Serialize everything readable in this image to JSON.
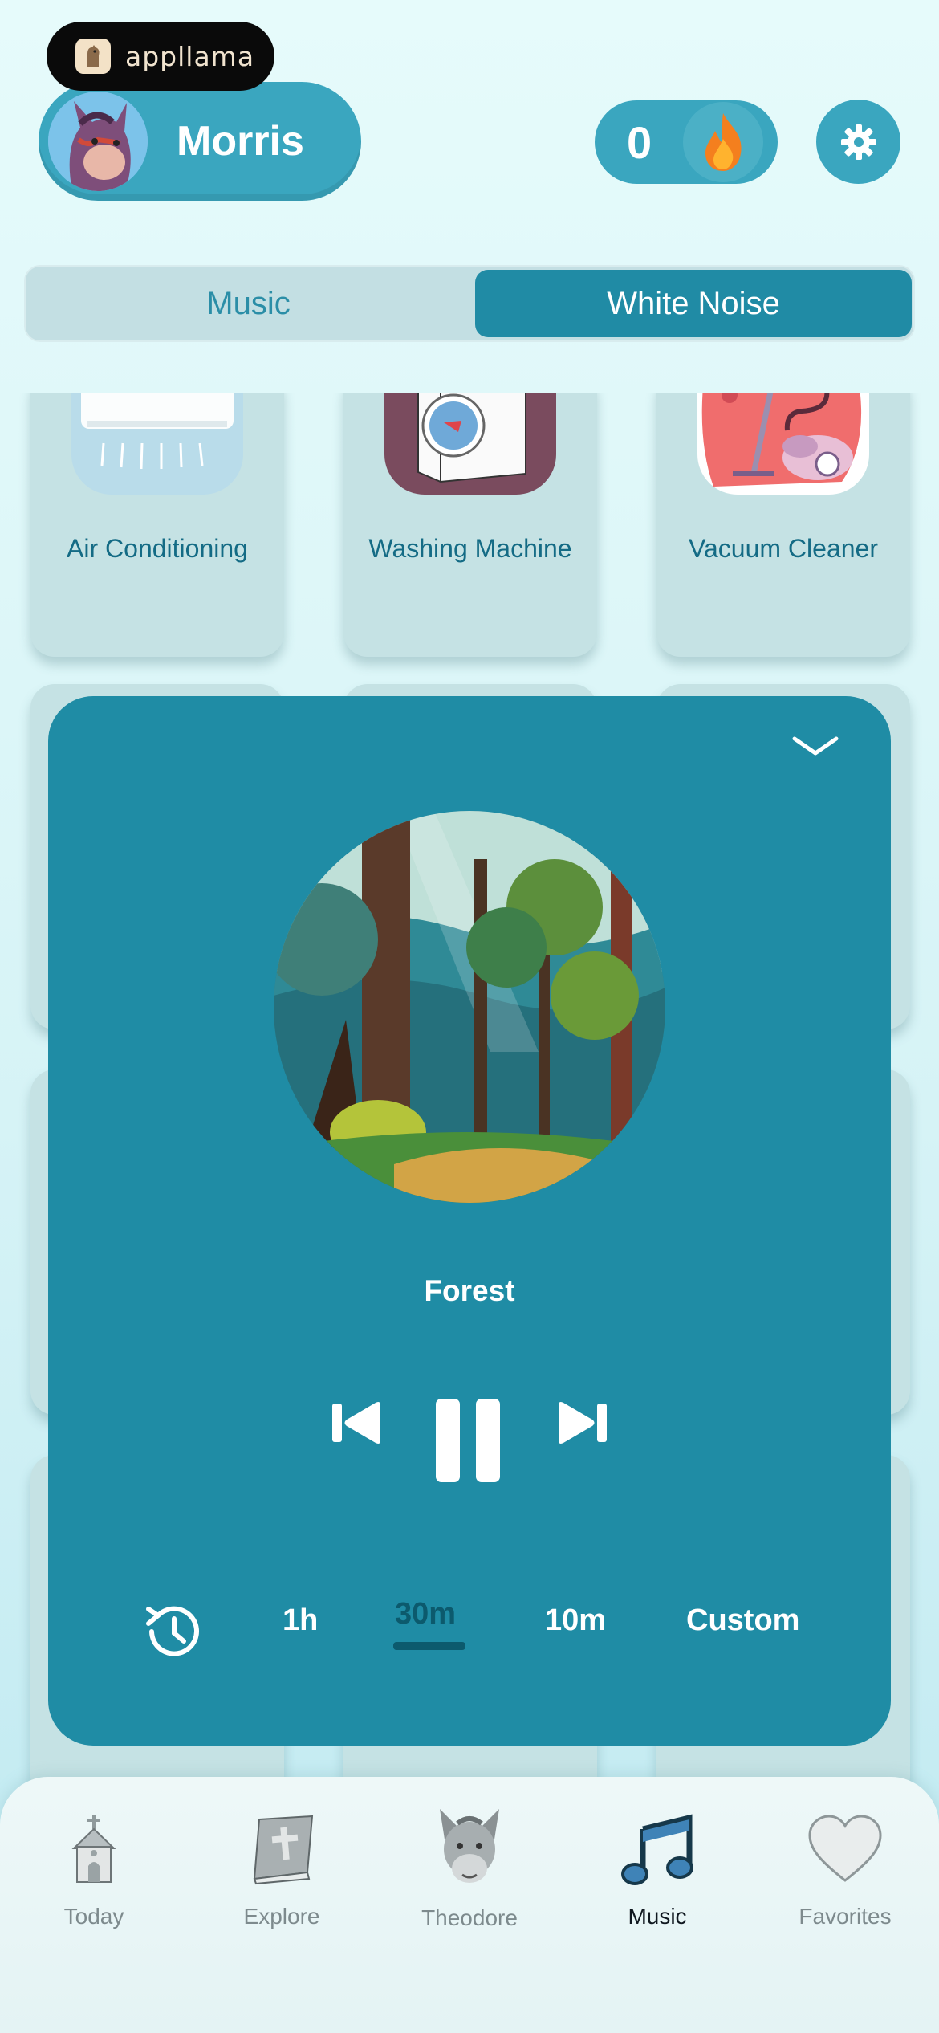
{
  "brand": {
    "name": "appllama"
  },
  "profile": {
    "name": "Morris"
  },
  "streak": {
    "count": "0"
  },
  "segments": {
    "left": "Music",
    "right": "White Noise",
    "active": "White Noise"
  },
  "sounds": [
    {
      "label": "Air Conditioning"
    },
    {
      "label": "Washing Machine"
    },
    {
      "label": "Vacuum Cleaner"
    }
  ],
  "player": {
    "track": "Forest",
    "timers": [
      "1h",
      "30m",
      "10m",
      "Custom"
    ],
    "selected_timer": "30m"
  },
  "tabbar": {
    "items": [
      {
        "label": "Today",
        "icon": "church-icon"
      },
      {
        "label": "Explore",
        "icon": "bible-icon"
      },
      {
        "label": "Theodore",
        "icon": "donkey-icon"
      },
      {
        "label": "Music",
        "icon": "music-note-icon"
      },
      {
        "label": "Favorites",
        "icon": "heart-icon"
      }
    ],
    "active": "Music"
  },
  "colors": {
    "accent": "#3aa6bf",
    "player_bg": "#1f8ca5",
    "segment_active": "#208ba5",
    "label_teal": "#146b85"
  }
}
